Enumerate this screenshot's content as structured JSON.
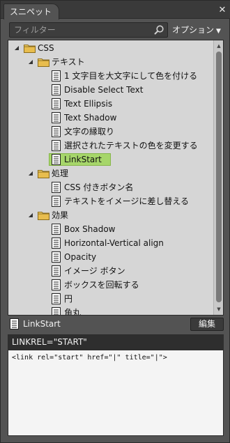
{
  "panel": {
    "title": "スニペット",
    "close_glyph": "✕"
  },
  "filter": {
    "placeholder": "フィルター",
    "value": ""
  },
  "options_label": "オプション",
  "tree": [
    {
      "kind": "folder",
      "label": "CSS",
      "level": 0,
      "expanded": true
    },
    {
      "kind": "folder",
      "label": "テキスト",
      "level": 1,
      "expanded": true
    },
    {
      "kind": "item",
      "label": "1 文字目を大文字にして色を付ける",
      "level": 2
    },
    {
      "kind": "item",
      "label": "Disable Select Text",
      "level": 2
    },
    {
      "kind": "item",
      "label": "Text Ellipsis",
      "level": 2
    },
    {
      "kind": "item",
      "label": "Text Shadow",
      "level": 2
    },
    {
      "kind": "item",
      "label": "文字の縁取り",
      "level": 2
    },
    {
      "kind": "item",
      "label": "選択されたテキストの色を変更する",
      "level": 2
    },
    {
      "kind": "item",
      "label": "LinkStart",
      "level": 2,
      "selected": true
    },
    {
      "kind": "folder",
      "label": "処理",
      "level": 1,
      "expanded": true
    },
    {
      "kind": "item",
      "label": "CSS 付きボタン名",
      "level": 2
    },
    {
      "kind": "item",
      "label": "テキストをイメージに差し替える",
      "level": 2
    },
    {
      "kind": "folder",
      "label": "効果",
      "level": 1,
      "expanded": true
    },
    {
      "kind": "item",
      "label": "Box Shadow",
      "level": 2
    },
    {
      "kind": "item",
      "label": "Horizontal-Vertical align",
      "level": 2
    },
    {
      "kind": "item",
      "label": "Opacity",
      "level": 2
    },
    {
      "kind": "item",
      "label": "イメージ ボタン",
      "level": 2
    },
    {
      "kind": "item",
      "label": "ボックスを回転する",
      "level": 2
    },
    {
      "kind": "item",
      "label": "円",
      "level": 2
    },
    {
      "kind": "item",
      "label": "角丸",
      "level": 2
    }
  ],
  "detail": {
    "title": "LinkStart",
    "edit_label": "編集",
    "trigger": "LINKREL=\"START\"",
    "code": "<link rel=\"start\" href=\"|\" title=\"|\">"
  },
  "colors": {
    "selected": "#a6d66a",
    "folder": "#e8c15a",
    "panel": "#535353"
  }
}
